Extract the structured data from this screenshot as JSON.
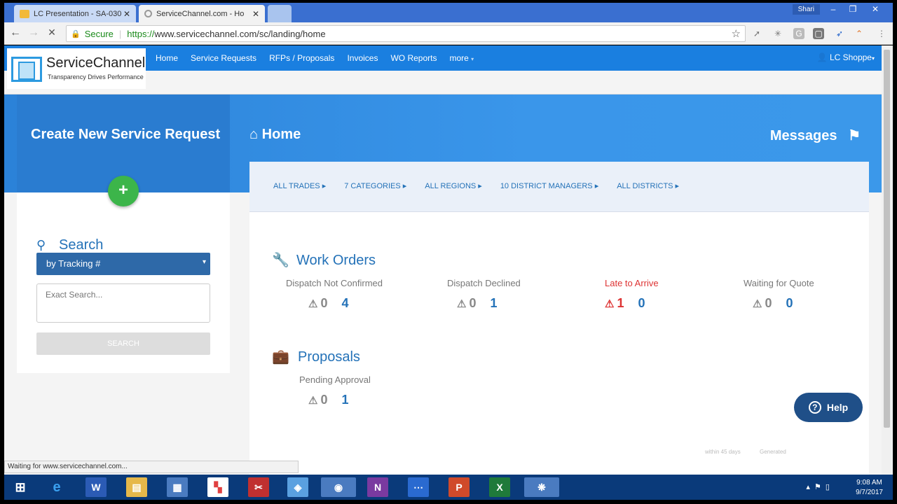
{
  "browser": {
    "tabs": [
      {
        "title": "LC Presentation - SA-030"
      },
      {
        "title": "ServiceChannel.com - Ho"
      }
    ],
    "profile_name": "Shari",
    "secure_label": "Secure",
    "url_scheme": "https://",
    "url_rest": "www.servicechannel.com/sc/landing/home",
    "status_text": "Waiting for www.servicechannel.com..."
  },
  "app": {
    "logo_name": "ServiceChannel",
    "logo_tagline": "Transparency Drives Performance",
    "nav": [
      "Home",
      "Service Requests",
      "RFPs / Proposals",
      "Invoices",
      "WO Reports",
      "more"
    ],
    "user": "LC Shoppe"
  },
  "hero": {
    "create_title": "Create New Service Request",
    "home_title": "Home",
    "messages_title": "Messages"
  },
  "search": {
    "title": "Search",
    "select_value": "by Tracking #",
    "placeholder": "Exact Search...",
    "button": "SEARCH"
  },
  "filters": [
    "ALL TRADES",
    "7 CATEGORIES",
    "ALL REGIONS",
    "10 DISTRICT MANAGERS",
    "ALL DISTRICTS"
  ],
  "work_orders": {
    "title": "Work Orders",
    "metrics": [
      {
        "label": "Dispatch Not Confirmed",
        "alert_count": "0",
        "count": "4"
      },
      {
        "label": "Dispatch Declined",
        "alert_count": "0",
        "count": "1"
      },
      {
        "label": "Late to Arrive",
        "alert_count": "1",
        "count": "0"
      },
      {
        "label": "Waiting for Quote",
        "alert_count": "0",
        "count": "0"
      }
    ]
  },
  "proposals": {
    "title": "Proposals",
    "metrics": [
      {
        "label": "Pending Approval",
        "alert_count": "0",
        "count": "1"
      }
    ]
  },
  "footer_notes": [
    "within 45 days",
    "Generated"
  ],
  "help_label": "Help",
  "taskbar": {
    "time": "9:08 AM",
    "date": "9/7/2017"
  }
}
